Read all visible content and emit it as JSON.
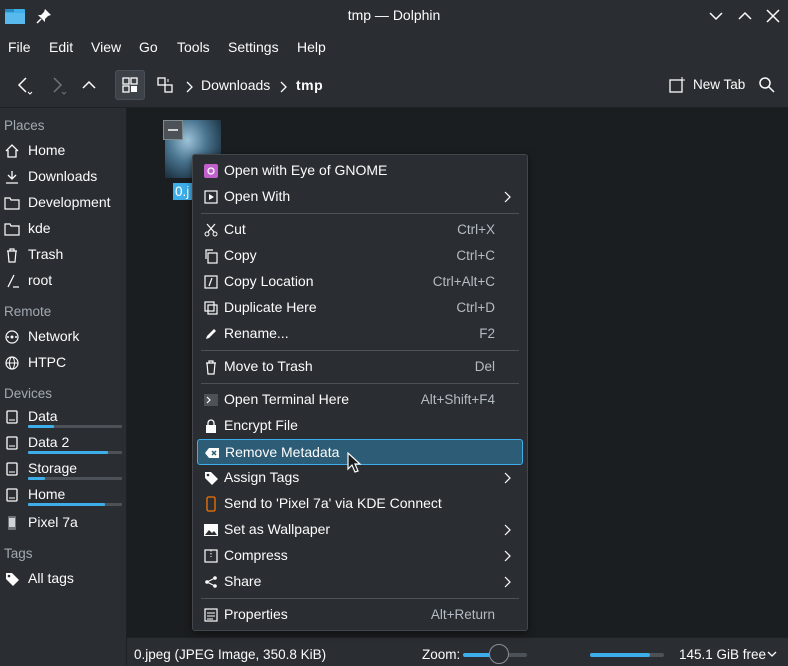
{
  "window": {
    "title": "tmp — Dolphin"
  },
  "menubar": [
    "File",
    "Edit",
    "View",
    "Go",
    "Tools",
    "Settings",
    "Help"
  ],
  "toolbar": {
    "crumbs": [
      "Downloads",
      "tmp"
    ],
    "new_tab": "New Tab"
  },
  "sidebar": {
    "places_head": "Places",
    "places": [
      "Home",
      "Downloads",
      "Development",
      "kde",
      "Trash",
      "root"
    ],
    "remote_head": "Remote",
    "remote": [
      "Network",
      "HTPC"
    ],
    "devices_head": "Devices",
    "devices": [
      {
        "label": "Data",
        "capacity": 0.28
      },
      {
        "label": "Data 2",
        "capacity": 0.85
      },
      {
        "label": "Storage",
        "capacity": 0.18
      },
      {
        "label": "Home",
        "capacity": 0.82
      },
      {
        "label": "Pixel 7a",
        "capacity": null
      }
    ],
    "tags_head": "Tags",
    "tags": [
      "All tags"
    ]
  },
  "file": {
    "name": "0.jpeg",
    "name_visible": "0.j"
  },
  "context_menu": {
    "items": [
      {
        "label": "Open with Eye of GNOME",
        "shortcut": ""
      },
      {
        "label": "Open With",
        "shortcut": ""
      },
      {
        "label": "Cut",
        "shortcut": "Ctrl+X"
      },
      {
        "label": "Copy",
        "shortcut": "Ctrl+C"
      },
      {
        "label": "Copy Location",
        "shortcut": "Ctrl+Alt+C"
      },
      {
        "label": "Duplicate Here",
        "shortcut": "Ctrl+D"
      },
      {
        "label": "Rename...",
        "shortcut": "F2"
      },
      {
        "label": "Move to Trash",
        "shortcut": "Del"
      },
      {
        "label": "Open Terminal Here",
        "shortcut": "Alt+Shift+F4"
      },
      {
        "label": "Encrypt File",
        "shortcut": ""
      },
      {
        "label": "Remove Metadata",
        "shortcut": ""
      },
      {
        "label": "Assign Tags",
        "shortcut": ""
      },
      {
        "label": "Send to 'Pixel 7a' via KDE Connect",
        "shortcut": ""
      },
      {
        "label": "Set as Wallpaper",
        "shortcut": ""
      },
      {
        "label": "Compress",
        "shortcut": ""
      },
      {
        "label": "Share",
        "shortcut": ""
      },
      {
        "label": "Properties",
        "shortcut": "Alt+Return"
      }
    ]
  },
  "statusbar": {
    "info": "0.jpeg (JPEG Image, 350.8 KiB)",
    "zoom_label": "Zoom:",
    "free": "145.1 GiB free"
  },
  "colors": {
    "accent": "#3daee9",
    "highlight": "#2d5c76",
    "bg": "#2a2e32",
    "view_bg": "#1b1e20"
  }
}
